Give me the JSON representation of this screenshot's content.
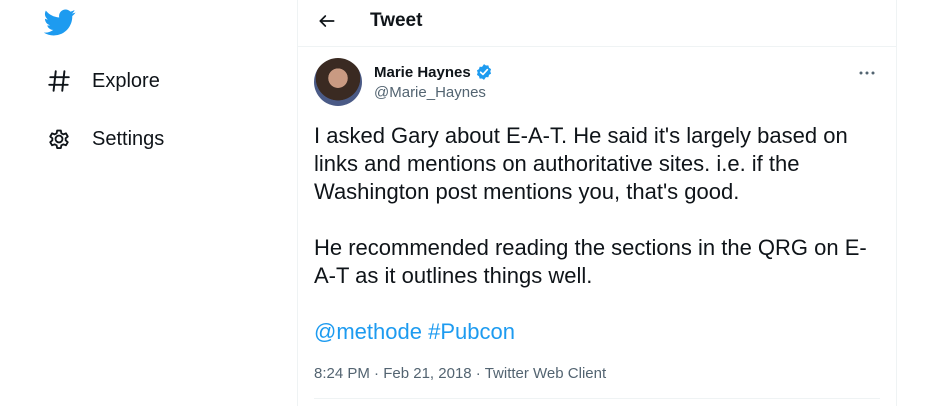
{
  "nav": {
    "explore_label": "Explore",
    "settings_label": "Settings"
  },
  "header": {
    "title": "Tweet"
  },
  "tweet": {
    "author_name": "Marie Haynes",
    "author_handle": "@Marie_Haynes",
    "paragraph_1": "I asked Gary about E-A-T. He said it's largely based on links and mentions on authoritative sites. i.e. if the Washington post mentions you, that's good.",
    "paragraph_2": "He recommended reading the sections in the QRG on E-A-T as it outlines things well.",
    "mention": "@methode",
    "hashtag": "#Pubcon",
    "time": "8:24 PM",
    "date": "Feb 21, 2018",
    "client": "Twitter Web Client",
    "separator": "·"
  },
  "colors": {
    "brand": "#1d9bf0",
    "text": "#0f1419",
    "muted": "#536471",
    "border": "#eff3f4"
  },
  "icons": {
    "logo": "twitter-bird-icon",
    "explore": "hashtag-icon",
    "settings": "gear-icon",
    "back": "arrow-left-icon",
    "verified": "verified-badge-icon",
    "more": "more-horizontal-icon"
  }
}
